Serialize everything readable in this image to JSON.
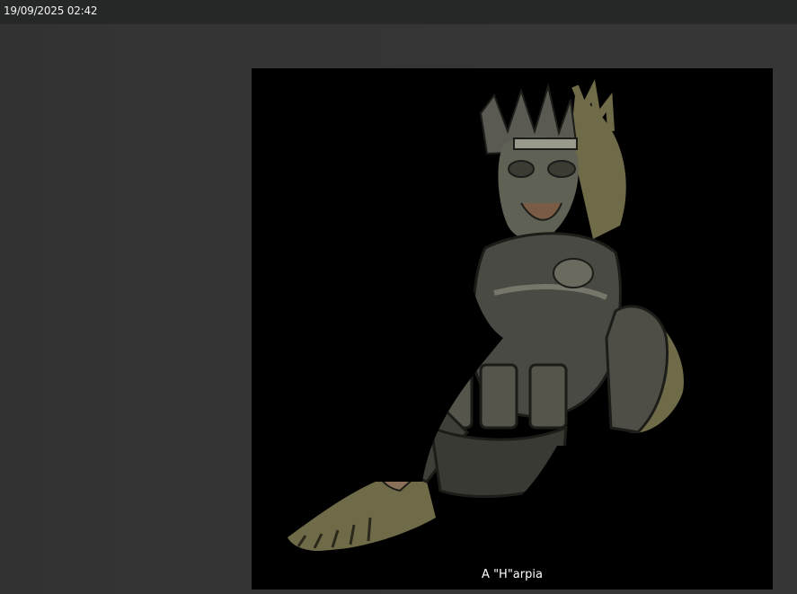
{
  "topbar": {
    "timestamp": "19/09/2025 02:42"
  },
  "viewer": {
    "caption": "A \"H\"arpia",
    "image_subject": "armored-harpy-soldier-illustration",
    "colors": {
      "background": "#000000",
      "wing": "#6f6a48",
      "armor": "#4a4a44",
      "armor_light": "#77766a",
      "skin": "#8a7058"
    }
  }
}
